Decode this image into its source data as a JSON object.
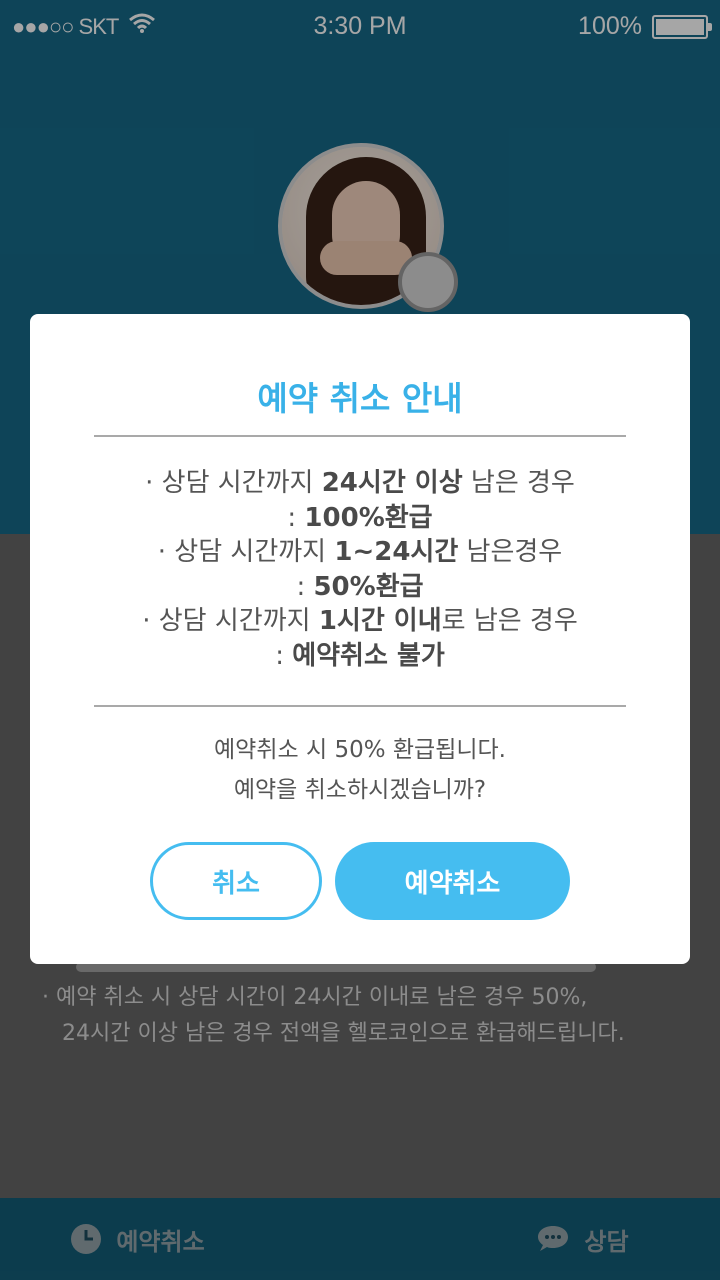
{
  "status_bar": {
    "carrier": "●●●○○ SKT",
    "time": "3:30 PM",
    "battery": "100%",
    "battery_level": 1.0
  },
  "background_notes": [
    "· 예약 취소 시 상담 시간이 24시간 이내로 남은 경우 50%,",
    "24시간 이상 남은 경우 전액을 헬로코인으로 환급해드립니다."
  ],
  "bottom_bar": {
    "cancel_tab": "예약취소",
    "consult_tab": "상담"
  },
  "modal": {
    "title": "예약 취소 안내",
    "rule1": {
      "prefix": "· 상담 시간까지 ",
      "bold": "24시간 이상",
      "suffix": " 남은 경우"
    },
    "rule1_result": {
      "prefix": ": ",
      "bold": "100%환급"
    },
    "rule2": {
      "prefix": "· 상담 시간까지 ",
      "bold": "1~24시간",
      "suffix": " 남은경우"
    },
    "rule2_result": {
      "prefix": ": ",
      "bold": "50%환급"
    },
    "rule3": {
      "prefix": "· 상담 시간까지 ",
      "bold": "1시간 이내",
      "suffix": "로 남은 경우"
    },
    "rule3_result": {
      "prefix": ": ",
      "bold": "예약취소 불가"
    },
    "message_line1": "예약취소 시 50% 환급됩니다.",
    "message_line2": "예약을 취소하시겠습니까?",
    "cancel_button": "취소",
    "confirm_button": "예약취소"
  },
  "colors": {
    "accent": "#45bdf0",
    "header": "#1b81a6",
    "overlay_gray": "#666666"
  }
}
